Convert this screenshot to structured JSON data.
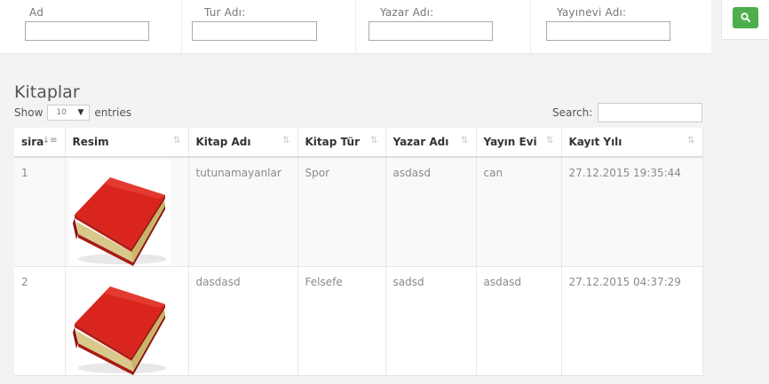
{
  "filters": [
    {
      "label": "Ad",
      "value": ""
    },
    {
      "label": "Tur Adı:",
      "value": ""
    },
    {
      "label": "Yazar Adı:",
      "value": ""
    },
    {
      "label": "Yayınevi Adı:",
      "value": ""
    }
  ],
  "search_button": {
    "icon": "search-icon"
  },
  "page_title": "Kitaplar",
  "length_menu": {
    "show_label": "Show",
    "selected": "10",
    "entries_label": "entries"
  },
  "table_search": {
    "label": "Search:",
    "value": ""
  },
  "columns": [
    "sira",
    "Resim",
    "Kitap Adı",
    "Kitap Tür",
    "Yazar Adı",
    "Yayın Evi",
    "Kayıt Yılı"
  ],
  "rows": [
    {
      "sira": "1",
      "image": "book-image",
      "kitap_adi": "tutunamayanlar",
      "kitap_tur": "Spor",
      "yazar_adi": "asdasd",
      "yayin_evi": "can",
      "kayit_yili": "27.12.2015 19:35:44"
    },
    {
      "sira": "2",
      "image": "book-image",
      "kitap_adi": "dasdasd",
      "kitap_tur": "Felsefe",
      "yazar_adi": "sadsd",
      "yayin_evi": "asdasd",
      "kayit_yili": "27.12.2015 04:37:29"
    }
  ],
  "colors": {
    "accent": "#4cae4c",
    "header_text": "#333333",
    "cell_text": "#8a8a8a",
    "book_red": "#d9251d"
  }
}
